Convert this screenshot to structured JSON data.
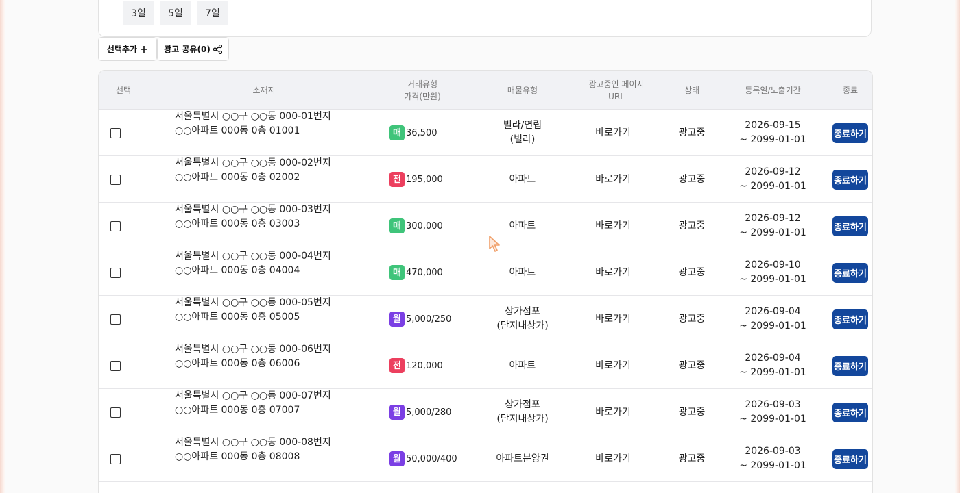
{
  "filter": {
    "days": [
      "3일",
      "5일",
      "7일"
    ]
  },
  "actions": {
    "add_selected_label": "선택추가",
    "share_label": "광고 공유(0)"
  },
  "table": {
    "headers": {
      "select": "선택",
      "address": "소재지",
      "deal_type_line1": "거래유형",
      "deal_type_line2": "가격(만원)",
      "property_type": "매물유형",
      "ad_page_line1": "광고중인 페이지",
      "ad_page_line2": "URL",
      "status": "상태",
      "date": "등록일/노출기간",
      "end": "종료"
    },
    "rows": [
      {
        "addr1": "서울특별시 ○○구 ○○동 000-01번지",
        "addr2": "○○아파트 000동 0층 01001",
        "badge": "매",
        "badge_color": "#3fc47a",
        "price": "36,500",
        "type1": "빌라/연립",
        "type2": "(빌라)",
        "url": "바로가기",
        "status": "광고중",
        "date1": "2026-09-15",
        "date2": "~ 2099-01-01",
        "end": "종료하기"
      },
      {
        "addr1": "서울특별시 ○○구 ○○동 000-02번지",
        "addr2": "○○아파트 000동 0층 02002",
        "badge": "전",
        "badge_color": "#ec3f5e",
        "price": "195,000",
        "type1": "아파트",
        "type2": "",
        "url": "바로가기",
        "status": "광고중",
        "date1": "2026-09-12",
        "date2": "~ 2099-01-01",
        "end": "종료하기"
      },
      {
        "addr1": "서울특별시 ○○구 ○○동 000-03번지",
        "addr2": "○○아파트 000동 0층 03003",
        "badge": "매",
        "badge_color": "#3fc47a",
        "price": "300,000",
        "type1": "아파트",
        "type2": "",
        "url": "바로가기",
        "status": "광고중",
        "date1": "2026-09-12",
        "date2": "~ 2099-01-01",
        "end": "종료하기"
      },
      {
        "addr1": "서울특별시 ○○구 ○○동 000-04번지",
        "addr2": "○○아파트 000동 0층 04004",
        "badge": "매",
        "badge_color": "#3fc47a",
        "price": "470,000",
        "type1": "아파트",
        "type2": "",
        "url": "바로가기",
        "status": "광고중",
        "date1": "2026-09-10",
        "date2": "~ 2099-01-01",
        "end": "종료하기"
      },
      {
        "addr1": "서울특별시 ○○구 ○○동 000-05번지",
        "addr2": "○○아파트 000동 0층 05005",
        "badge": "월",
        "badge_color": "#7b3fe4",
        "price": "5,000/250",
        "type1": "상가점포",
        "type2": "(단지내상가)",
        "url": "바로가기",
        "status": "광고중",
        "date1": "2026-09-04",
        "date2": "~ 2099-01-01",
        "end": "종료하기"
      },
      {
        "addr1": "서울특별시 ○○구 ○○동 000-06번지",
        "addr2": "○○아파트 000동 0층 06006",
        "badge": "전",
        "badge_color": "#ec3f5e",
        "price": "120,000",
        "type1": "아파트",
        "type2": "",
        "url": "바로가기",
        "status": "광고중",
        "date1": "2026-09-04",
        "date2": "~ 2099-01-01",
        "end": "종료하기"
      },
      {
        "addr1": "서울특별시 ○○구 ○○동 000-07번지",
        "addr2": "○○아파트 000동 0층 07007",
        "badge": "월",
        "badge_color": "#7b3fe4",
        "price": "5,000/280",
        "type1": "상가점포",
        "type2": "(단지내상가)",
        "url": "바로가기",
        "status": "광고중",
        "date1": "2026-09-03",
        "date2": "~ 2099-01-01",
        "end": "종료하기"
      },
      {
        "addr1": "서울특별시 ○○구 ○○동 000-08번지",
        "addr2": "○○아파트 000동 0층 08008",
        "badge": "월",
        "badge_color": "#7b3fe4",
        "price": "50,000/400",
        "type1": "아파트분양권",
        "type2": "",
        "url": "바로가기",
        "status": "광고중",
        "date1": "2026-09-03",
        "date2": "~ 2099-01-01",
        "end": "종료하기"
      }
    ]
  },
  "colors": {
    "primary_button": "#13479c",
    "badge_sale": "#3fc47a",
    "badge_jeonse": "#ec3f5e",
    "badge_monthly": "#7b3fe4",
    "cursor": "#f0a06a"
  },
  "icons": {
    "plus": "plus-icon",
    "share": "share-icon",
    "cursor": "mouse-cursor-icon"
  }
}
